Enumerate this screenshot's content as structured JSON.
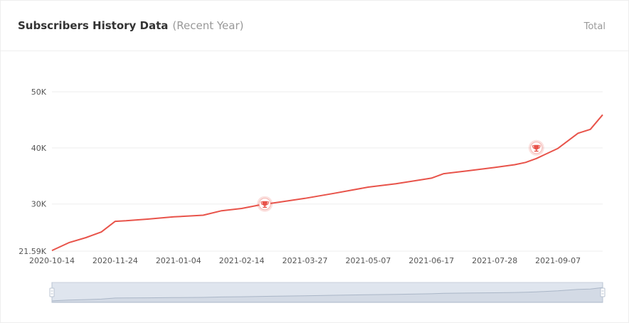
{
  "header": {
    "title": "Subscribers History Data",
    "subtitle": "(Recent Year)",
    "total_label": "Total"
  },
  "colors": {
    "series": "#e8534a",
    "grid": "#eeeeee",
    "zoom_fill": "#dfe5ee",
    "zoom_border": "#c8d0dc",
    "handle": "#b8c3d2"
  },
  "chart_data": {
    "type": "line",
    "x_ticks": [
      "2020-10-14",
      "2020-11-24",
      "2021-01-04",
      "2021-02-14",
      "2021-03-27",
      "2021-05-07",
      "2021-06-17",
      "2021-07-28",
      "2021-09-07"
    ],
    "y_ticks": [
      "21.59K",
      "30K",
      "40K",
      "50K"
    ],
    "ylim": [
      21590,
      50000
    ],
    "xlim": [
      "2020-10-14",
      "2021-10-06"
    ],
    "grid": true,
    "series": [
      {
        "x": [
          "2020-10-14",
          "2020-10-25",
          "2020-11-05",
          "2020-11-15",
          "2020-11-24",
          "2020-12-01",
          "2020-12-15",
          "2021-01-01",
          "2021-01-20",
          "2021-02-01",
          "2021-02-14",
          "2021-02-27",
          "2021-03-10",
          "2021-03-27",
          "2021-04-15",
          "2021-05-07",
          "2021-05-25",
          "2021-06-17",
          "2021-06-25",
          "2021-07-10",
          "2021-07-28",
          "2021-08-10",
          "2021-08-17",
          "2021-08-24",
          "2021-09-07",
          "2021-09-20",
          "2021-09-28",
          "2021-10-06"
        ],
        "y": [
          21700,
          23100,
          24000,
          25000,
          26900,
          27000,
          27300,
          27700,
          28000,
          28800,
          29200,
          29900,
          30300,
          31000,
          31900,
          33000,
          33600,
          34600,
          35400,
          35900,
          36500,
          37000,
          37400,
          38100,
          39900,
          42600,
          43300,
          45900
        ]
      }
    ],
    "markers": [
      {
        "x": "2021-03-01",
        "y": 30000,
        "icon": "trophy-icon"
      },
      {
        "x": "2021-08-24",
        "y": 40000,
        "icon": "trophy-icon"
      }
    ]
  }
}
